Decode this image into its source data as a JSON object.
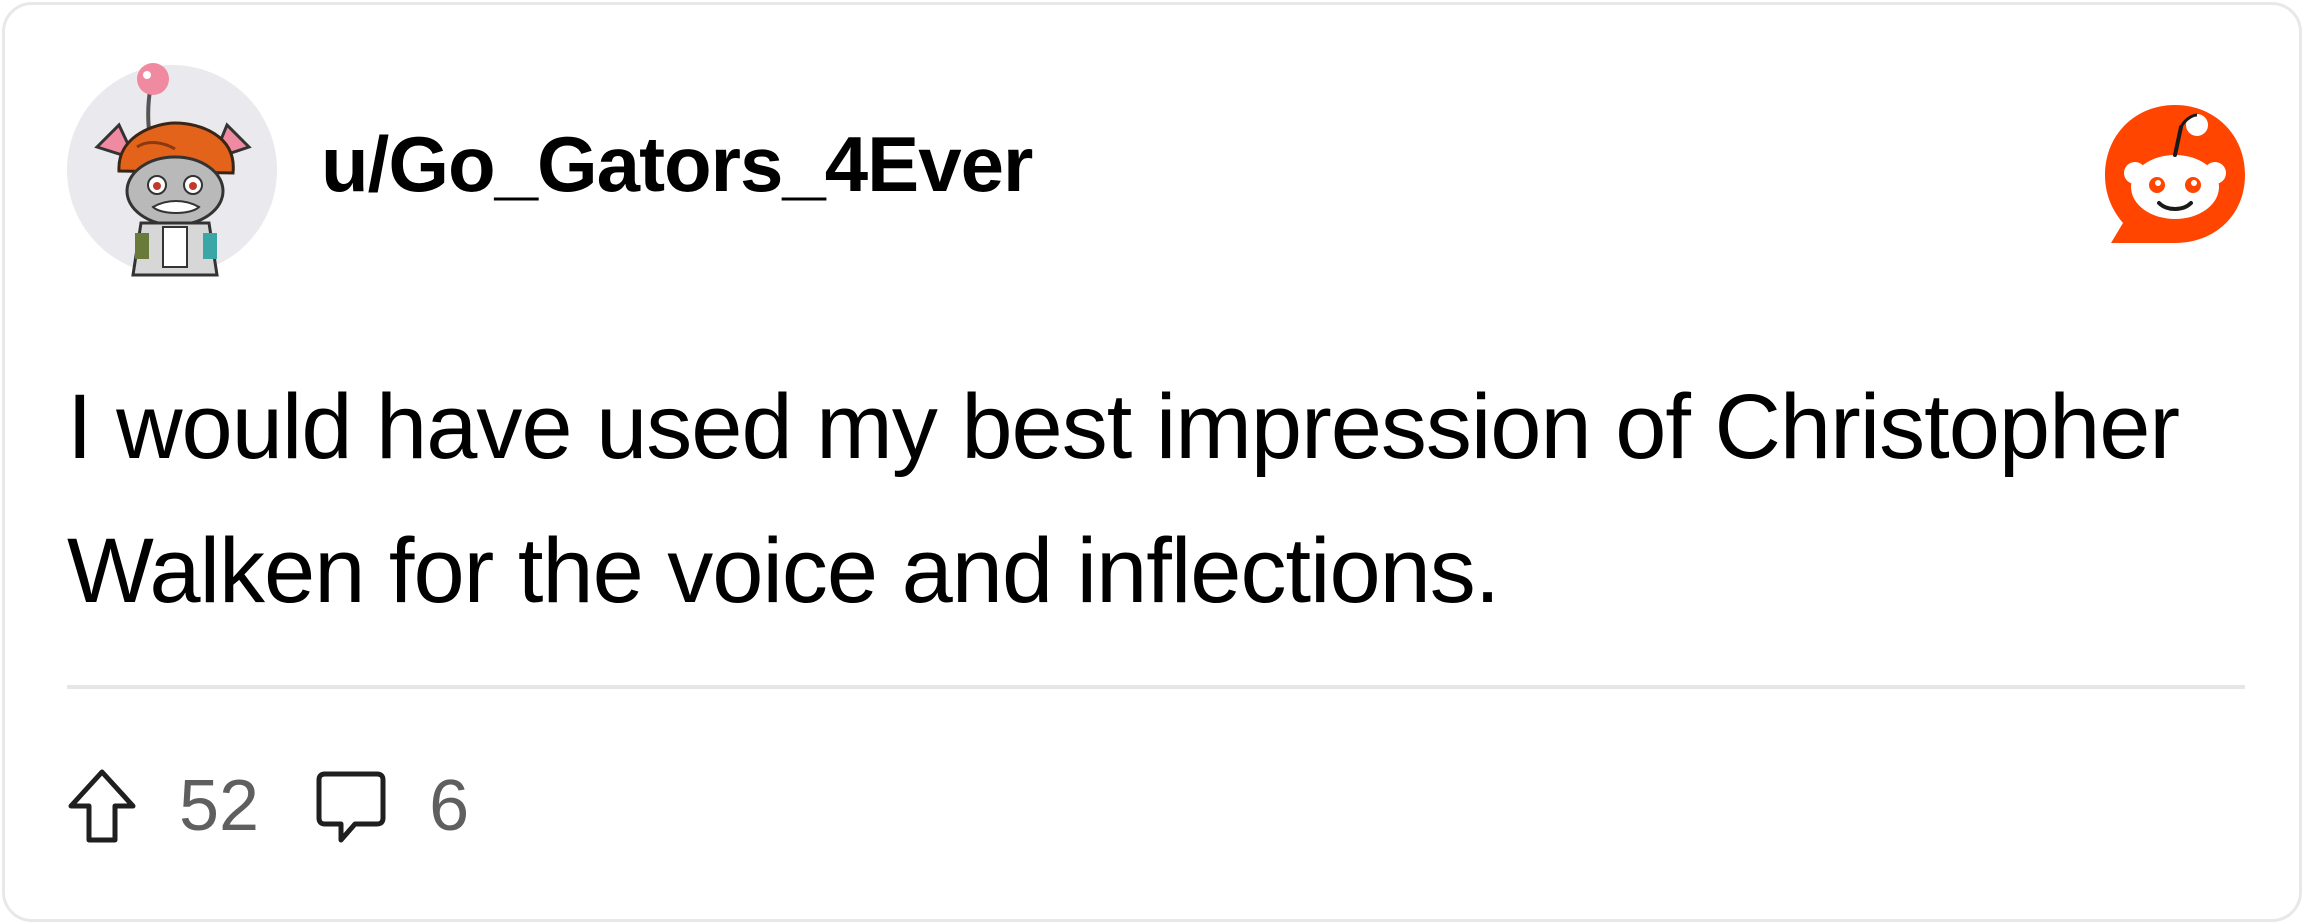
{
  "post": {
    "username": "u/Go_Gators_4Ever",
    "avatar_icon": "snoo-avatar-icon",
    "brand_icon": "reddit-logo-icon",
    "text": "I would have used my best impression of Christopher Walken for the voice and inflections.",
    "upvotes": "52",
    "comments": "6"
  },
  "colors": {
    "brand": "#ff4500",
    "text": "#000000",
    "muted": "#5f5f5f",
    "border": "#e8e8e8"
  }
}
